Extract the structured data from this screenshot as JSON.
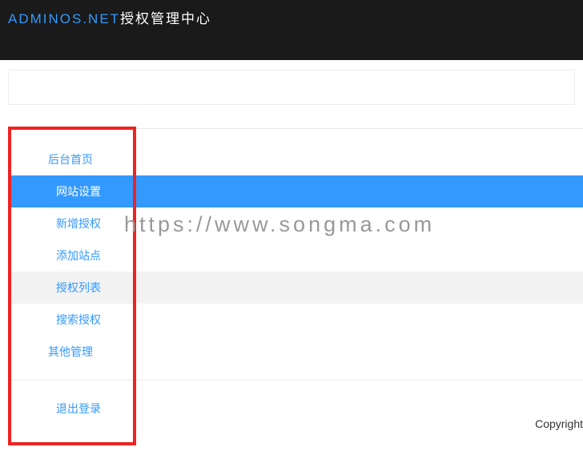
{
  "header": {
    "brand": "ADMINOS.NET",
    "suffix": "授权管理中心"
  },
  "sidebar": {
    "items": [
      {
        "label": "后台首页",
        "active": false,
        "level": 1
      },
      {
        "label": "网站设置",
        "active": true,
        "level": 2
      },
      {
        "label": "新增授权",
        "active": false,
        "level": 2
      },
      {
        "label": "添加站点",
        "active": false,
        "level": 2
      },
      {
        "label": "授权列表",
        "active": false,
        "level": 2,
        "highlight": true
      },
      {
        "label": "搜索授权",
        "active": false,
        "level": 2
      },
      {
        "label": "其他管理",
        "active": false,
        "level": 1
      }
    ],
    "logout": "退出登录"
  },
  "watermark": "https://www.songma.com",
  "footer": {
    "copyright": "Copyright"
  }
}
